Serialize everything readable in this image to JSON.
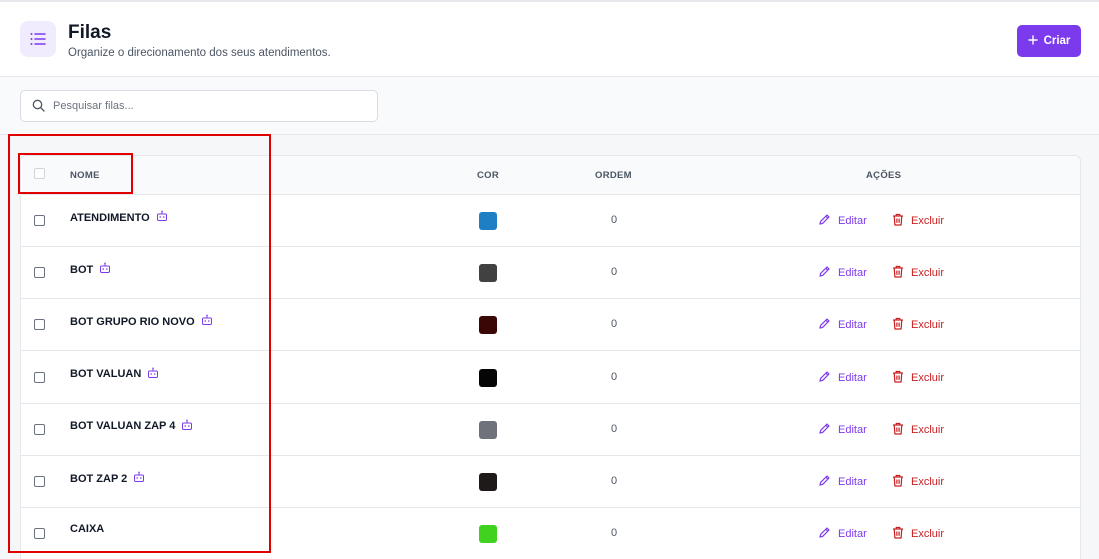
{
  "header": {
    "title": "Filas",
    "subtitle": "Organize o direcionamento dos seus atendimentos.",
    "icon": "list-icon",
    "create_label": "Criar"
  },
  "search": {
    "placeholder": "Pesquisar filas...",
    "value": ""
  },
  "table": {
    "columns": [
      "NOME",
      "COR",
      "ORDEM",
      "AÇÕES"
    ],
    "edit_label": "Editar",
    "delete_label": "Excluir",
    "rows": [
      {
        "name": "ATENDIMENTO",
        "color": "#1e7fc4",
        "order": "0",
        "bot": true
      },
      {
        "name": "BOT",
        "color": "#414141",
        "order": "0",
        "bot": true
      },
      {
        "name": "BOT GRUPO RIO NOVO",
        "color": "#3a0606",
        "order": "0",
        "bot": true
      },
      {
        "name": "BOT VALUAN",
        "color": "#050505",
        "order": "0",
        "bot": true
      },
      {
        "name": "BOT VALUAN ZAP 4",
        "color": "#6f727a",
        "order": "0",
        "bot": true
      },
      {
        "name": "BOT ZAP 2",
        "color": "#1e1a1a",
        "order": "0",
        "bot": true
      },
      {
        "name": "CAIXA",
        "color": "#3fd21f",
        "order": "0",
        "bot": false
      }
    ]
  },
  "colors": {
    "accent": "#7c3aed",
    "danger": "#c81e1e",
    "highlight": "#e00000"
  }
}
